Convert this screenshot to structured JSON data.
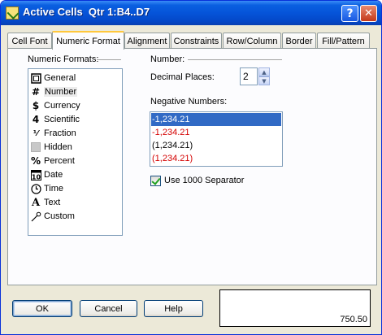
{
  "window": {
    "title": "Active Cells  Qtr 1:B4..D7",
    "help_glyph": "?",
    "close_glyph": "✕"
  },
  "tabs": [
    {
      "label": "Cell Font",
      "active": false
    },
    {
      "label": "Numeric Format",
      "active": true
    },
    {
      "label": "Alignment",
      "active": false
    },
    {
      "label": "Constraints",
      "active": false
    },
    {
      "label": "Row/Column",
      "active": false
    },
    {
      "label": "Border",
      "active": false
    },
    {
      "label": "Fill/Pattern",
      "active": false
    }
  ],
  "numeric_formats": {
    "group_label": "Numeric Formats:",
    "selected": "Number",
    "items": [
      {
        "label": "General",
        "icon": "general-icon"
      },
      {
        "label": "Number",
        "icon": "number-icon"
      },
      {
        "label": "Currency",
        "icon": "currency-icon"
      },
      {
        "label": "Scientific",
        "icon": "scientific-icon"
      },
      {
        "label": "Fraction",
        "icon": "fraction-icon"
      },
      {
        "label": "Hidden",
        "icon": "hidden-icon"
      },
      {
        "label": "Percent",
        "icon": "percent-icon"
      },
      {
        "label": "Date",
        "icon": "date-icon"
      },
      {
        "label": "Time",
        "icon": "time-icon"
      },
      {
        "label": "Text",
        "icon": "text-icon"
      },
      {
        "label": "Custom",
        "icon": "custom-icon"
      }
    ]
  },
  "number_options": {
    "group_label": "Number:",
    "decimal_places_label": "Decimal Places:",
    "decimal_places_value": "2",
    "negative_numbers_label": "Negative Numbers:",
    "negative_numbers": [
      {
        "label": "-1,234.21",
        "color": "#000000",
        "selected": true
      },
      {
        "label": "-1,234.21",
        "color": "#d40000",
        "selected": false
      },
      {
        "label": "(1,234.21)",
        "color": "#000000",
        "selected": false
      },
      {
        "label": "(1,234.21)",
        "color": "#d40000",
        "selected": false
      }
    ],
    "separator_label": "Use 1000 Separator",
    "separator_checked": true
  },
  "buttons": {
    "ok": "OK",
    "cancel": "Cancel",
    "help": "Help"
  },
  "preview": {
    "value": "750.50"
  }
}
